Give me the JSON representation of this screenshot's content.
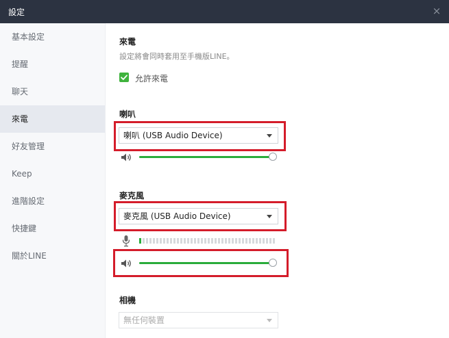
{
  "window": {
    "title": "設定",
    "close_glyph": "×"
  },
  "sidebar": {
    "items": [
      {
        "label": "基本設定",
        "active": false
      },
      {
        "label": "提醒",
        "active": false
      },
      {
        "label": "聊天",
        "active": false
      },
      {
        "label": "來電",
        "active": true
      },
      {
        "label": "好友管理",
        "active": false
      },
      {
        "label": "Keep",
        "active": false
      },
      {
        "label": "進階設定",
        "active": false
      },
      {
        "label": "快捷鍵",
        "active": false
      },
      {
        "label": "關於LINE",
        "active": false
      }
    ]
  },
  "calls": {
    "title": "來電",
    "subtitle": "設定將會同時套用至手機版LINE。",
    "allow_calls": {
      "label": "允許來電",
      "checked": true
    }
  },
  "speaker": {
    "title": "喇叭",
    "device": "喇叭 (USB Audio Device)",
    "volume": 1.0
  },
  "microphone": {
    "title": "麥克風",
    "device": "麥克風 (USB Audio Device)",
    "input_level_segments_active": 1,
    "input_level_segments_total": 40,
    "volume": 1.0
  },
  "camera": {
    "title": "相機",
    "device": "無任何裝置",
    "disabled": true
  },
  "colors": {
    "accent_green": "#29ac3a",
    "highlight_red": "#d41c2a",
    "titlebar": "#2c3341"
  },
  "icons": [
    "close-icon",
    "checkmark-icon",
    "speaker-icon",
    "microphone-icon",
    "chevron-down-icon"
  ]
}
